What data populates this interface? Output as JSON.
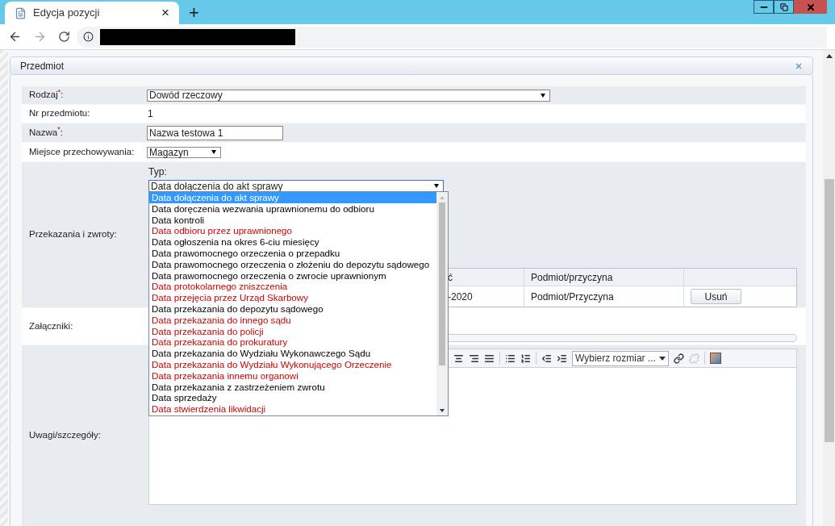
{
  "browser": {
    "tab_title": "Edycja pozycji",
    "tab_close": "×",
    "new_tab": "+"
  },
  "panel": {
    "title": "Przedmiot"
  },
  "form": {
    "rodzaj": {
      "label": "Rodzaj$^{*}$:",
      "value": "Dowód rzeczowy"
    },
    "nr": {
      "label": "Nr przedmiotu:",
      "value": "1"
    },
    "nazwa": {
      "label": "Nazwa$^{*}$:",
      "value": "Nazwa testowa 1"
    },
    "miejsce": {
      "label": "Miejsce przechowywania:",
      "value": "Magazyn"
    },
    "przekazania": {
      "label": "Przekazania i zwroty:",
      "typ_label": "Typ:",
      "typ_value": "Data dołączenia do akt sprawy",
      "expanded": true,
      "options": [
        {
          "label": "Data dołączenia do akt sprawy",
          "selected": true
        },
        {
          "label": "Data doręczenia wezwania uprawnionemu do odbioru",
          "selected": false,
          "color": "#000000"
        },
        {
          "label": "Data kontroli",
          "selected": false,
          "color": "#000000"
        },
        {
          "label": "Data odbioru przez uprawnionego",
          "selected": false,
          "color": "#cc0000"
        },
        {
          "label": "Data ogłoszenia na okres 6-ciu miesięcy",
          "selected": false,
          "color": "#000000"
        },
        {
          "label": "Data prawomocnego orzeczenia o przepadku",
          "selected": false,
          "color": "#000000"
        },
        {
          "label": "Data prawomocnego orzeczenia o złożeniu do depozytu sądowego",
          "selected": false,
          "color": "#000000"
        },
        {
          "label": "Data prawomocnego orzeczenia o zwrocie uprawnionym",
          "selected": false,
          "color": "#000000"
        },
        {
          "label": "Data protokolarnego zniszczenia",
          "selected": false,
          "color": "#cc0000"
        },
        {
          "label": "Data przejęcia przez Urząd Skarbowy",
          "selected": false,
          "color": "#cc0000"
        },
        {
          "label": "Data przekazania do depozytu sądowego",
          "selected": false,
          "color": "#000000"
        },
        {
          "label": "Data przekazania do innego sądu",
          "selected": false,
          "color": "#cc0000"
        },
        {
          "label": "Data przekazania do policji",
          "selected": false,
          "color": "#cc0000"
        },
        {
          "label": "Data przekazania do prokuratury",
          "selected": false,
          "color": "#cc0000"
        },
        {
          "label": "Data przekazania do Wydziału Wykonawczego Sądu",
          "selected": false,
          "color": "#000000"
        },
        {
          "label": "Data przekazania do Wydziału Wykonującego Orzeczenie",
          "selected": false,
          "color": "#cc0000"
        },
        {
          "label": "Data przekazania innemu organowi",
          "selected": false,
          "color": "#cc0000"
        },
        {
          "label": "Data przekazania z zastrzeżeniem zwrotu",
          "selected": false,
          "color": "#000000"
        },
        {
          "label": "Data sprzedaży",
          "selected": false,
          "color": "#000000"
        },
        {
          "label": "Data stwierdzenia likwidacji",
          "selected": false,
          "color": "#cc0000"
        }
      ],
      "table": {
        "columns": [
          "ć",
          "Podmiot/przyczyna"
        ],
        "rows": [
          {
            "cells": [
              "-2020",
              "Podmiot/Przyczyna"
            ],
            "action": "Usuń"
          }
        ]
      }
    },
    "zalaczniki": {
      "label": "Załączniki:",
      "upload": {
        "level": 0
      }
    },
    "uwagi": {
      "label": "Uwagi/szczegóły:",
      "size_placeholder": "Wybierz rozmiar ...",
      "tools": [
        {
          "kind": "align-center",
          "disabled": false
        },
        {
          "kind": "align-right",
          "disabled": false
        },
        {
          "kind": "align-justify",
          "disabled": false
        },
        {
          "kind": "sep"
        },
        {
          "kind": "bullets",
          "disabled": false
        },
        {
          "kind": "numbers",
          "disabled": false
        },
        {
          "kind": "sep"
        },
        {
          "kind": "outdent",
          "disabled": false
        },
        {
          "kind": "indent",
          "disabled": false
        },
        {
          "kind": "size"
        },
        {
          "kind": "link",
          "disabled": false
        },
        {
          "kind": "unlink",
          "disabled": true
        },
        {
          "kind": "sep"
        },
        {
          "kind": "image",
          "disabled": false
        }
      ]
    }
  }
}
